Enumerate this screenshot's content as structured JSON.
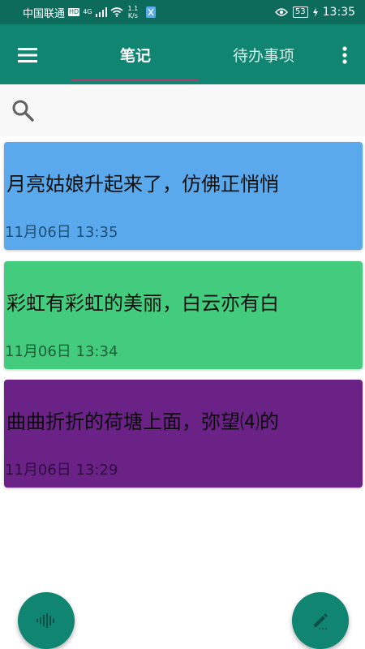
{
  "status_bar": {
    "carrier": "中国联通",
    "hd_label": "HD",
    "network_label": "4G",
    "speed_value": "1.1",
    "speed_unit": "K/s",
    "battery": "53",
    "time": "13:35"
  },
  "app_bar": {
    "tabs": [
      {
        "label": "笔记",
        "active": true
      },
      {
        "label": "待办事项",
        "active": false
      }
    ]
  },
  "notes": [
    {
      "title": "月亮姑娘升起来了，仿佛正悄悄",
      "date": "11月06日 13:35",
      "color": "#5aa9ec"
    },
    {
      "title": "彩虹有彩虹的美丽，白云亦有白",
      "date": "11月06日 13:34",
      "color": "#43cc7e"
    },
    {
      "title": "曲曲折折的荷塘上面，弥望⑷的",
      "date": "11月06日 13:29",
      "color": "#6a2287"
    }
  ],
  "colors": {
    "status_bar": "#0d6b5c",
    "app_bar": "#0f8572",
    "tab_indicator": "#b23a6b",
    "fab": "#0f8572"
  },
  "icons": {
    "menu": "hamburger-menu-icon",
    "more": "more-vertical-icon",
    "search": "search-icon",
    "voice": "voice-wave-icon",
    "edit": "edit-pencil-icon"
  }
}
